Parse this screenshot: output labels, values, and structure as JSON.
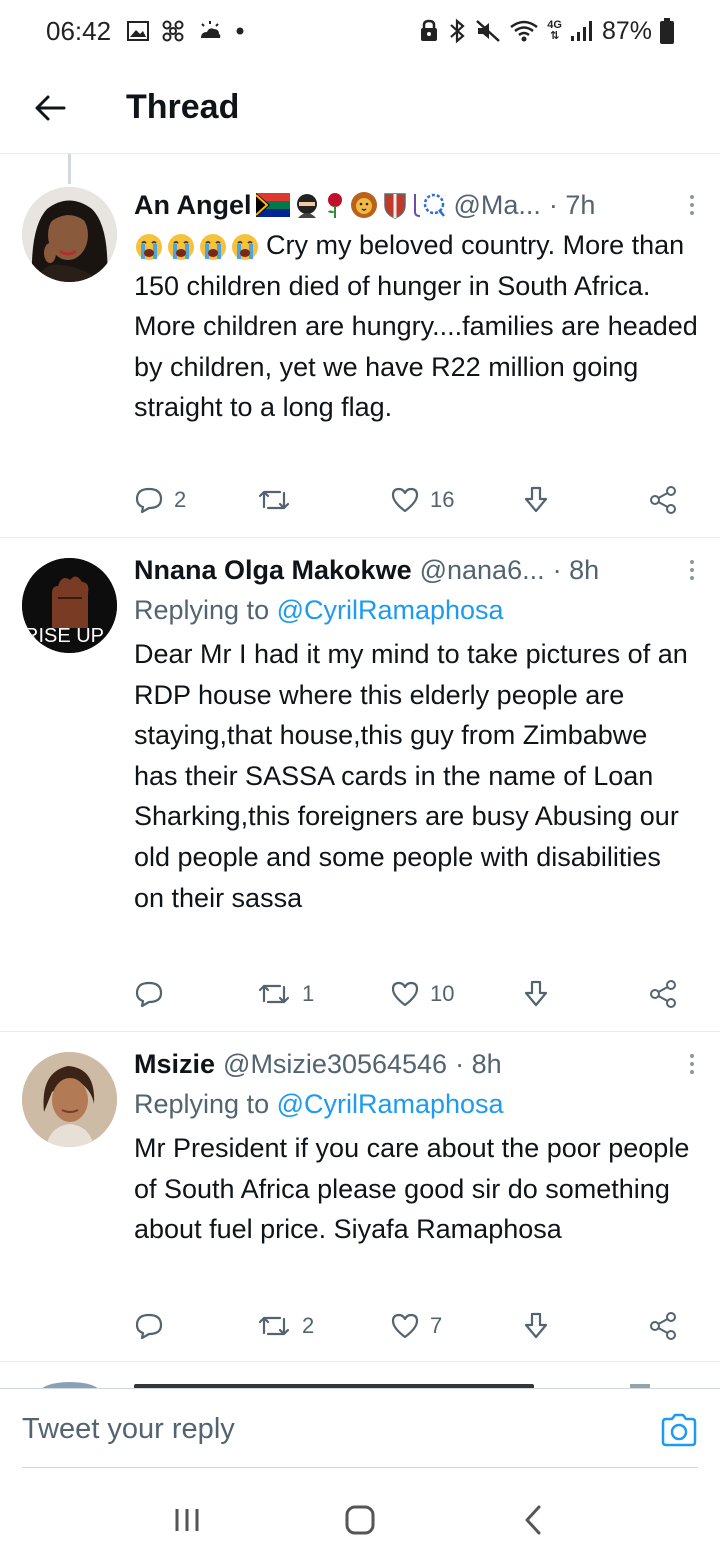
{
  "status_bar": {
    "time": "06:42",
    "network": "4G",
    "battery": "87%"
  },
  "header": {
    "title": "Thread"
  },
  "tweets": [
    {
      "name": "An Angel",
      "handle": "@Ma...",
      "time": "· 7h",
      "replying_prefix": "",
      "replying_to": "",
      "text": "Cry my beloved country. More than 150 children died of hunger in South Africa. More children are hungry....families are headed by children, yet we have R22 million going straight to a long flag.",
      "replies": "2",
      "retweets": "",
      "likes": "16"
    },
    {
      "name": "Nnana Olga Makokwe",
      "handle": "@nana6...",
      "time": "· 8h",
      "replying_prefix": "Replying to ",
      "replying_to": "@CyrilRamaphosa",
      "text": "Dear Mr I had it my mind to take pictures of an RDP house where this elderly people are staying,that house,this guy from Zimbabwe has their SASSA cards in the name of Loan Sharking,this foreigners are busy Abusing our old people and some people with disabilities on their sassa",
      "avatar_text": "RISE UP",
      "replies": "",
      "retweets": "1",
      "likes": "10"
    },
    {
      "name": "Msizie",
      "handle": "@Msizie30564546",
      "time": "· 8h",
      "replying_prefix": "Replying to ",
      "replying_to": "@CyrilRamaphosa",
      "text": "Mr President if you care about the poor people of South Africa please good sir do something about fuel price. Siyafa Ramaphosa",
      "replies": "",
      "retweets": "2",
      "likes": "7"
    }
  ],
  "reply_bar": {
    "placeholder": "Tweet your reply"
  },
  "colors": {
    "accent": "#1d9bf0",
    "secondary_text": "#536471",
    "divider": "#e6ecf0"
  }
}
